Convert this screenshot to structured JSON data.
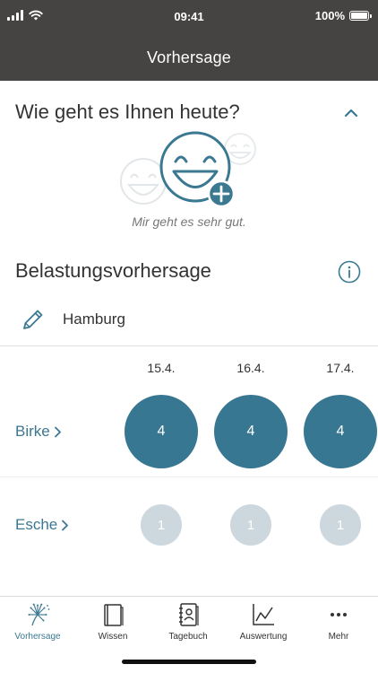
{
  "status_bar": {
    "time": "09:41",
    "battery": "100%"
  },
  "header": {
    "title": "Vorhersage"
  },
  "mood": {
    "title": "Wie geht es Ihnen heute?",
    "caption": "Mir geht es sehr gut."
  },
  "forecast": {
    "title": "Belastungsvorhersage",
    "location": "Hamburg",
    "dates": [
      "15.4.",
      "16.4.",
      "17.4."
    ],
    "plants": [
      {
        "name": "Birke",
        "levels": [
          "4",
          "4",
          "4"
        ]
      },
      {
        "name": "Esche",
        "levels": [
          "1",
          "1",
          "1"
        ]
      }
    ]
  },
  "tabbar": {
    "items": [
      {
        "label": "Vorhersage",
        "icon": "dandelion-icon",
        "active": true
      },
      {
        "label": "Wissen",
        "icon": "book-icon"
      },
      {
        "label": "Tagebuch",
        "icon": "diary-icon"
      },
      {
        "label": "Auswertung",
        "icon": "chart-icon"
      },
      {
        "label": "Mehr",
        "icon": "more-icon"
      }
    ]
  },
  "colors": {
    "header_bg": "#454443",
    "accent": "#3b7891",
    "high_level": "#387791",
    "low_level": "#cdd8de"
  }
}
